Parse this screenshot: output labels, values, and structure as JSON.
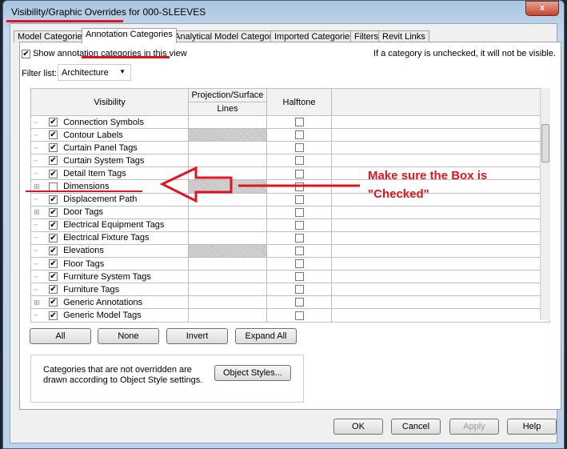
{
  "window": {
    "title": "Visibility/Graphic Overrides for 000-SLEEVES",
    "close": "x"
  },
  "tabs": [
    "Model Categories",
    "Annotation Categories",
    "Analytical Model Categories",
    "Imported Categories",
    "Filters",
    "Revit Links"
  ],
  "show_label": "Show annotation categories in this view",
  "hint": "If a category is unchecked, it will not be visible.",
  "filter_label": "Filter list:",
  "filter_value": "Architecture",
  "columns": {
    "visibility": "Visibility",
    "proj": "Projection/Surface",
    "lines": "Lines",
    "halftone": "Halftone"
  },
  "rows": [
    {
      "name": "Connection Symbols",
      "checked": true,
      "expand": false,
      "hatch": false
    },
    {
      "name": "Contour Labels",
      "checked": true,
      "expand": false,
      "hatch": true
    },
    {
      "name": "Curtain Panel Tags",
      "checked": true,
      "expand": false,
      "hatch": false
    },
    {
      "name": "Curtain System Tags",
      "checked": true,
      "expand": false,
      "hatch": false
    },
    {
      "name": "Detail Item Tags",
      "checked": true,
      "expand": false,
      "hatch": false
    },
    {
      "name": "Dimensions",
      "checked": false,
      "expand": true,
      "hatch": true
    },
    {
      "name": "Displacement Path",
      "checked": true,
      "expand": false,
      "hatch": false
    },
    {
      "name": "Door Tags",
      "checked": true,
      "expand": true,
      "hatch": false
    },
    {
      "name": "Electrical Equipment Tags",
      "checked": true,
      "expand": false,
      "hatch": false
    },
    {
      "name": "Electrical Fixture Tags",
      "checked": true,
      "expand": false,
      "hatch": false
    },
    {
      "name": "Elevations",
      "checked": true,
      "expand": false,
      "hatch": true
    },
    {
      "name": "Floor Tags",
      "checked": true,
      "expand": false,
      "hatch": false
    },
    {
      "name": "Furniture System Tags",
      "checked": true,
      "expand": false,
      "hatch": false
    },
    {
      "name": "Furniture Tags",
      "checked": true,
      "expand": false,
      "hatch": false
    },
    {
      "name": "Generic Annotations",
      "checked": true,
      "expand": true,
      "hatch": false
    },
    {
      "name": "Generic Model Tags",
      "checked": true,
      "expand": false,
      "hatch": false
    }
  ],
  "list_buttons": {
    "all": "All",
    "none": "None",
    "invert": "Invert",
    "expand": "Expand All"
  },
  "info": "Categories that are not overridden are drawn according to Object Style settings.",
  "object_styles": "Object Styles...",
  "footer": {
    "ok": "OK",
    "cancel": "Cancel",
    "apply": "Apply",
    "help": "Help"
  },
  "annotation": {
    "line1": "Make sure the Box is",
    "line2": "\"Checked\""
  }
}
